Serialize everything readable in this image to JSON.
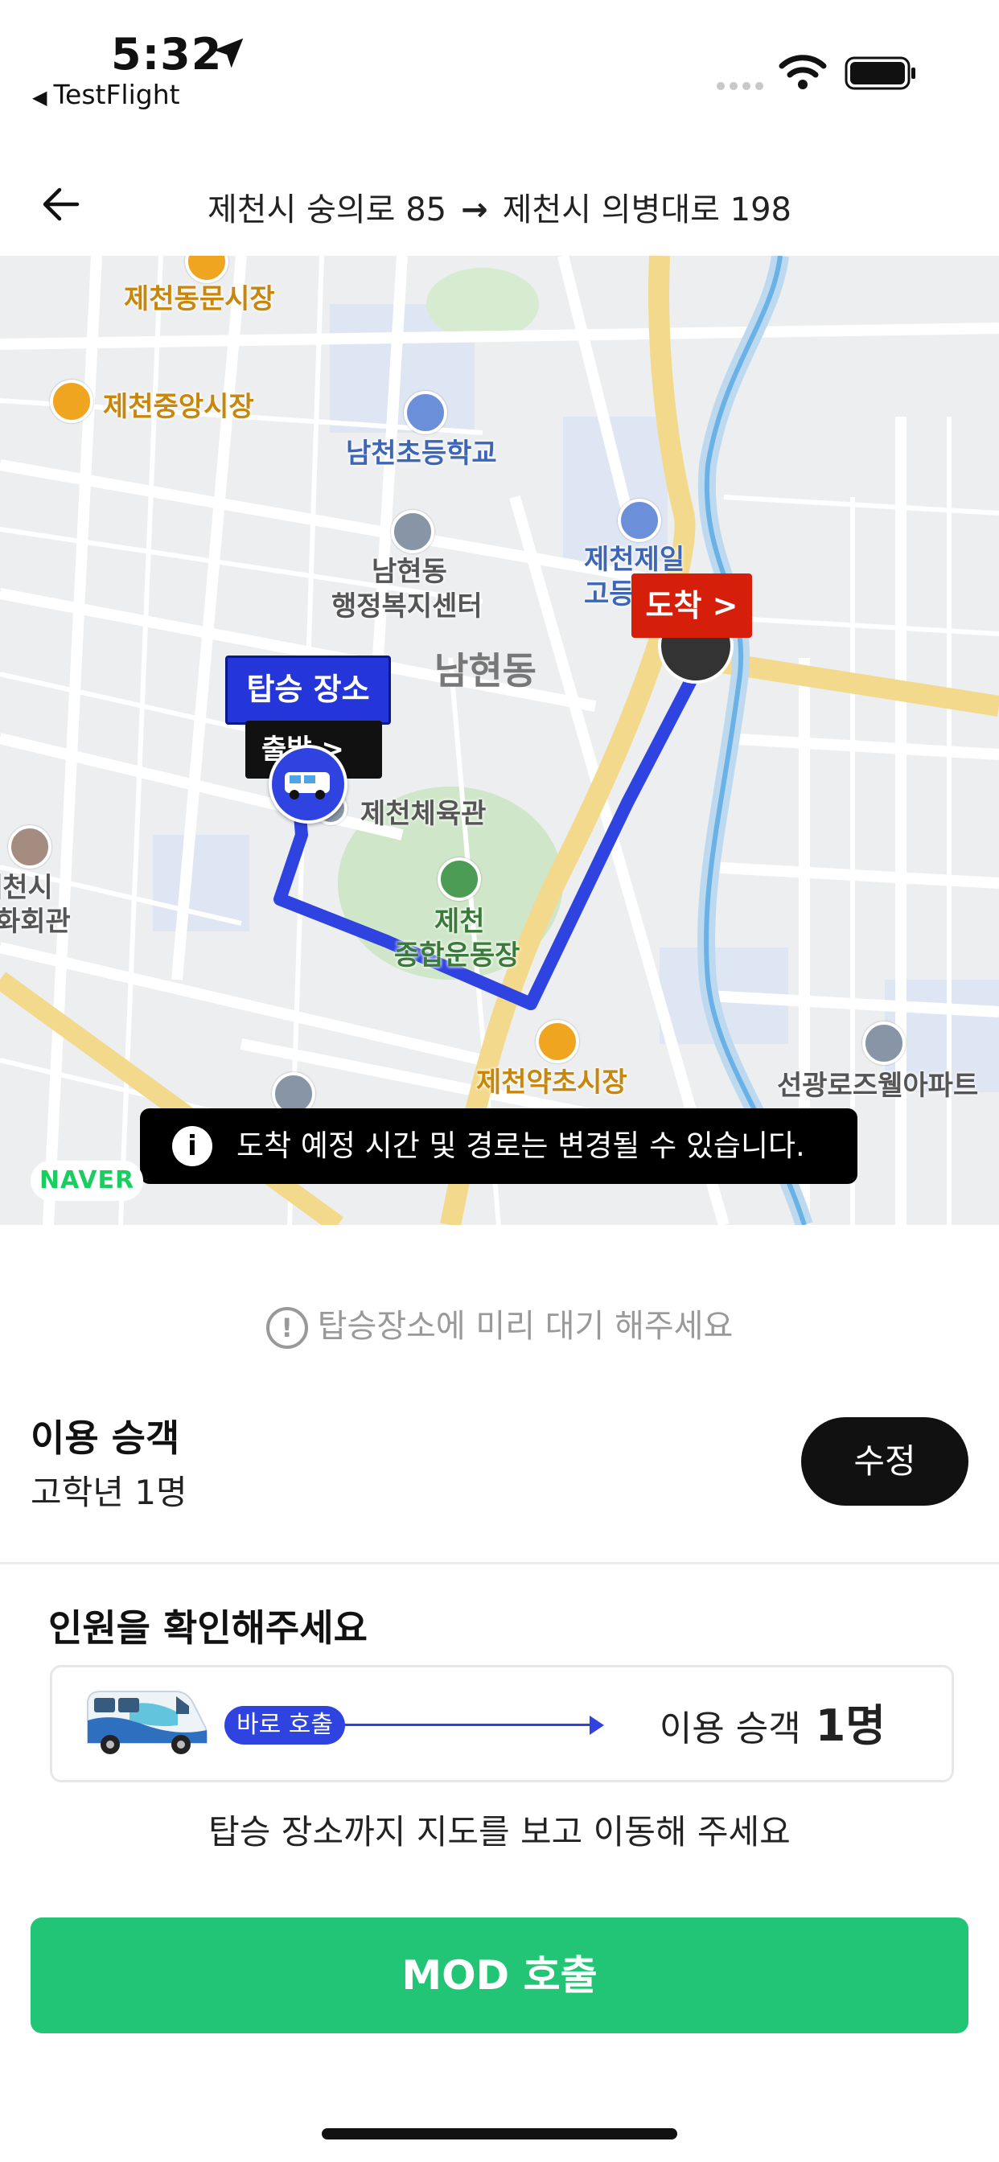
{
  "status_bar": {
    "time": "5:32",
    "back_app": "TestFlight"
  },
  "header": {
    "origin": "제천시 숭의로 85",
    "arrow": "→",
    "destination": "제천시 의병대로 198"
  },
  "map": {
    "pois": {
      "dongmun_market": "제천동문시장",
      "jungang_market": "제천중앙시장",
      "namcheon_school": "남천초등학교",
      "namhyeon_center_1": "남현동",
      "namhyeon_center_2": "행정복지센터",
      "jecheon_jeil_1": "제천제일",
      "jecheon_jeil_2": "고등",
      "namhyeon_dong": "남현동",
      "gym": "제천체육관",
      "sports_complex_1": "제천",
      "sports_complex_2": "종합운동장",
      "herb_market": "제천약초시장",
      "arts_hall_1": "제천시",
      "arts_hall_2": "화회관",
      "apartment": "선광로즈웰아파트"
    },
    "boarding_label": "탑승 장소",
    "start_label": "출발 >",
    "arrive_label": "도착 >",
    "notice": "도착 예정 시간 및 경로는 변경될 수 있습니다.",
    "naver_logo": "NAVER",
    "colors": {
      "route": "#2f43e0",
      "arrive": "#d61f0b",
      "boarding": "#2436d9"
    }
  },
  "hint": "탑승장소에 미리 대기 해주세요",
  "passengers": {
    "title": "이용 승객",
    "value": "고학년 1명",
    "edit_label": "수정"
  },
  "confirm": {
    "title": "인원을 확인해주세요",
    "call_badge": "바로 호출",
    "passenger_label": "이용 승객",
    "passenger_count": "1명"
  },
  "guide": "탑승 장소까지 지도를 보고 이동해 주세요",
  "primary_button": "MOD 호출",
  "accent_color": "#22c575"
}
